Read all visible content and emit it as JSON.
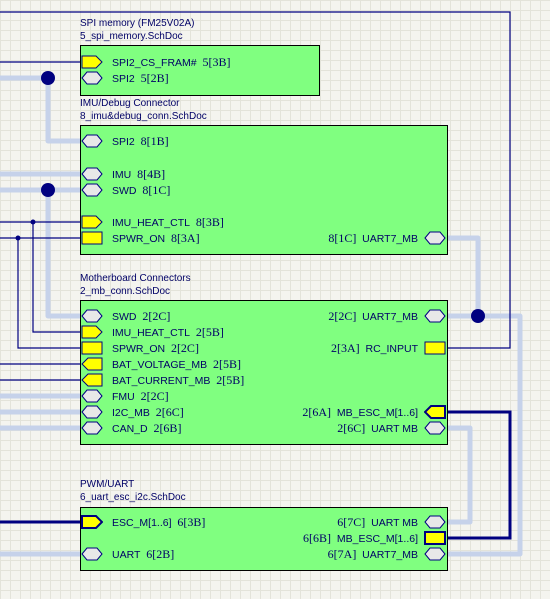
{
  "sheets": {
    "spi": {
      "title": "SPI memory (FM25V02A)",
      "file": "5_spi_memory.SchDoc",
      "ports": [
        {
          "name": "SPI2_CS_FRAM#",
          "ref": "5[3B]"
        },
        {
          "name": "SPI2",
          "ref": "5[2B]"
        }
      ]
    },
    "imu": {
      "title": "IMU/Debug Connector",
      "file": "8_imu&debug_conn.SchDoc",
      "ports_left": [
        {
          "name": "SPI2",
          "ref": "8[1B]"
        },
        {
          "name": "IMU",
          "ref": "8[4B]"
        },
        {
          "name": "SWD",
          "ref": "8[1C]"
        },
        {
          "name": "IMU_HEAT_CTL",
          "ref": "8[3B]"
        },
        {
          "name": "SPWR_ON",
          "ref": "8[3A]"
        }
      ],
      "ports_right": [
        {
          "name": "UART7_MB",
          "ref": "8[1C]"
        }
      ]
    },
    "mb": {
      "title": "Motherboard Connectors",
      "file": "2_mb_conn.SchDoc",
      "ports_left": [
        {
          "name": "SWD",
          "ref": "2[2C]"
        },
        {
          "name": "IMU_HEAT_CTL",
          "ref": "2[5B]"
        },
        {
          "name": "SPWR_ON",
          "ref": "2[2C]"
        },
        {
          "name": "BAT_VOLTAGE_MB",
          "ref": "2[5B]"
        },
        {
          "name": "BAT_CURRENT_MB",
          "ref": "2[5B]"
        },
        {
          "name": "FMU",
          "ref": "2[2C]"
        },
        {
          "name": "I2C_MB",
          "ref": "2[6C]"
        },
        {
          "name": "CAN_D",
          "ref": "2[6B]"
        }
      ],
      "ports_right": [
        {
          "name": "UART7_MB",
          "ref": "2[2C]"
        },
        {
          "name": "RC_INPUT",
          "ref": "2[3A]"
        },
        {
          "name": "MB_ESC_M[1..6]",
          "ref": "2[6A]"
        },
        {
          "name": "UART MB",
          "ref": "2[6C]"
        }
      ]
    },
    "pwm": {
      "title": "PWM/UART",
      "file": "6_uart_esc_i2c.SchDoc",
      "ports_left": [
        {
          "name": "ESC_M[1..6]",
          "ref": "6[3B]"
        },
        {
          "name": "UART",
          "ref": "6[2B]"
        }
      ],
      "ports_right": [
        {
          "name": "UART MB",
          "ref": "6[7C]"
        },
        {
          "name": "MB_ESC_M[1..6]",
          "ref": "6[6B]"
        },
        {
          "name": "UART7_MB",
          "ref": "6[7A]"
        }
      ]
    }
  },
  "colors": {
    "sheet_fill": "#80ff80",
    "port_fill": "#ffff00",
    "bus_port_fill": "#e8e8e8",
    "wire": "#000080",
    "bus": "#000080",
    "harness": "#c6d2ea",
    "text": "#000066"
  }
}
